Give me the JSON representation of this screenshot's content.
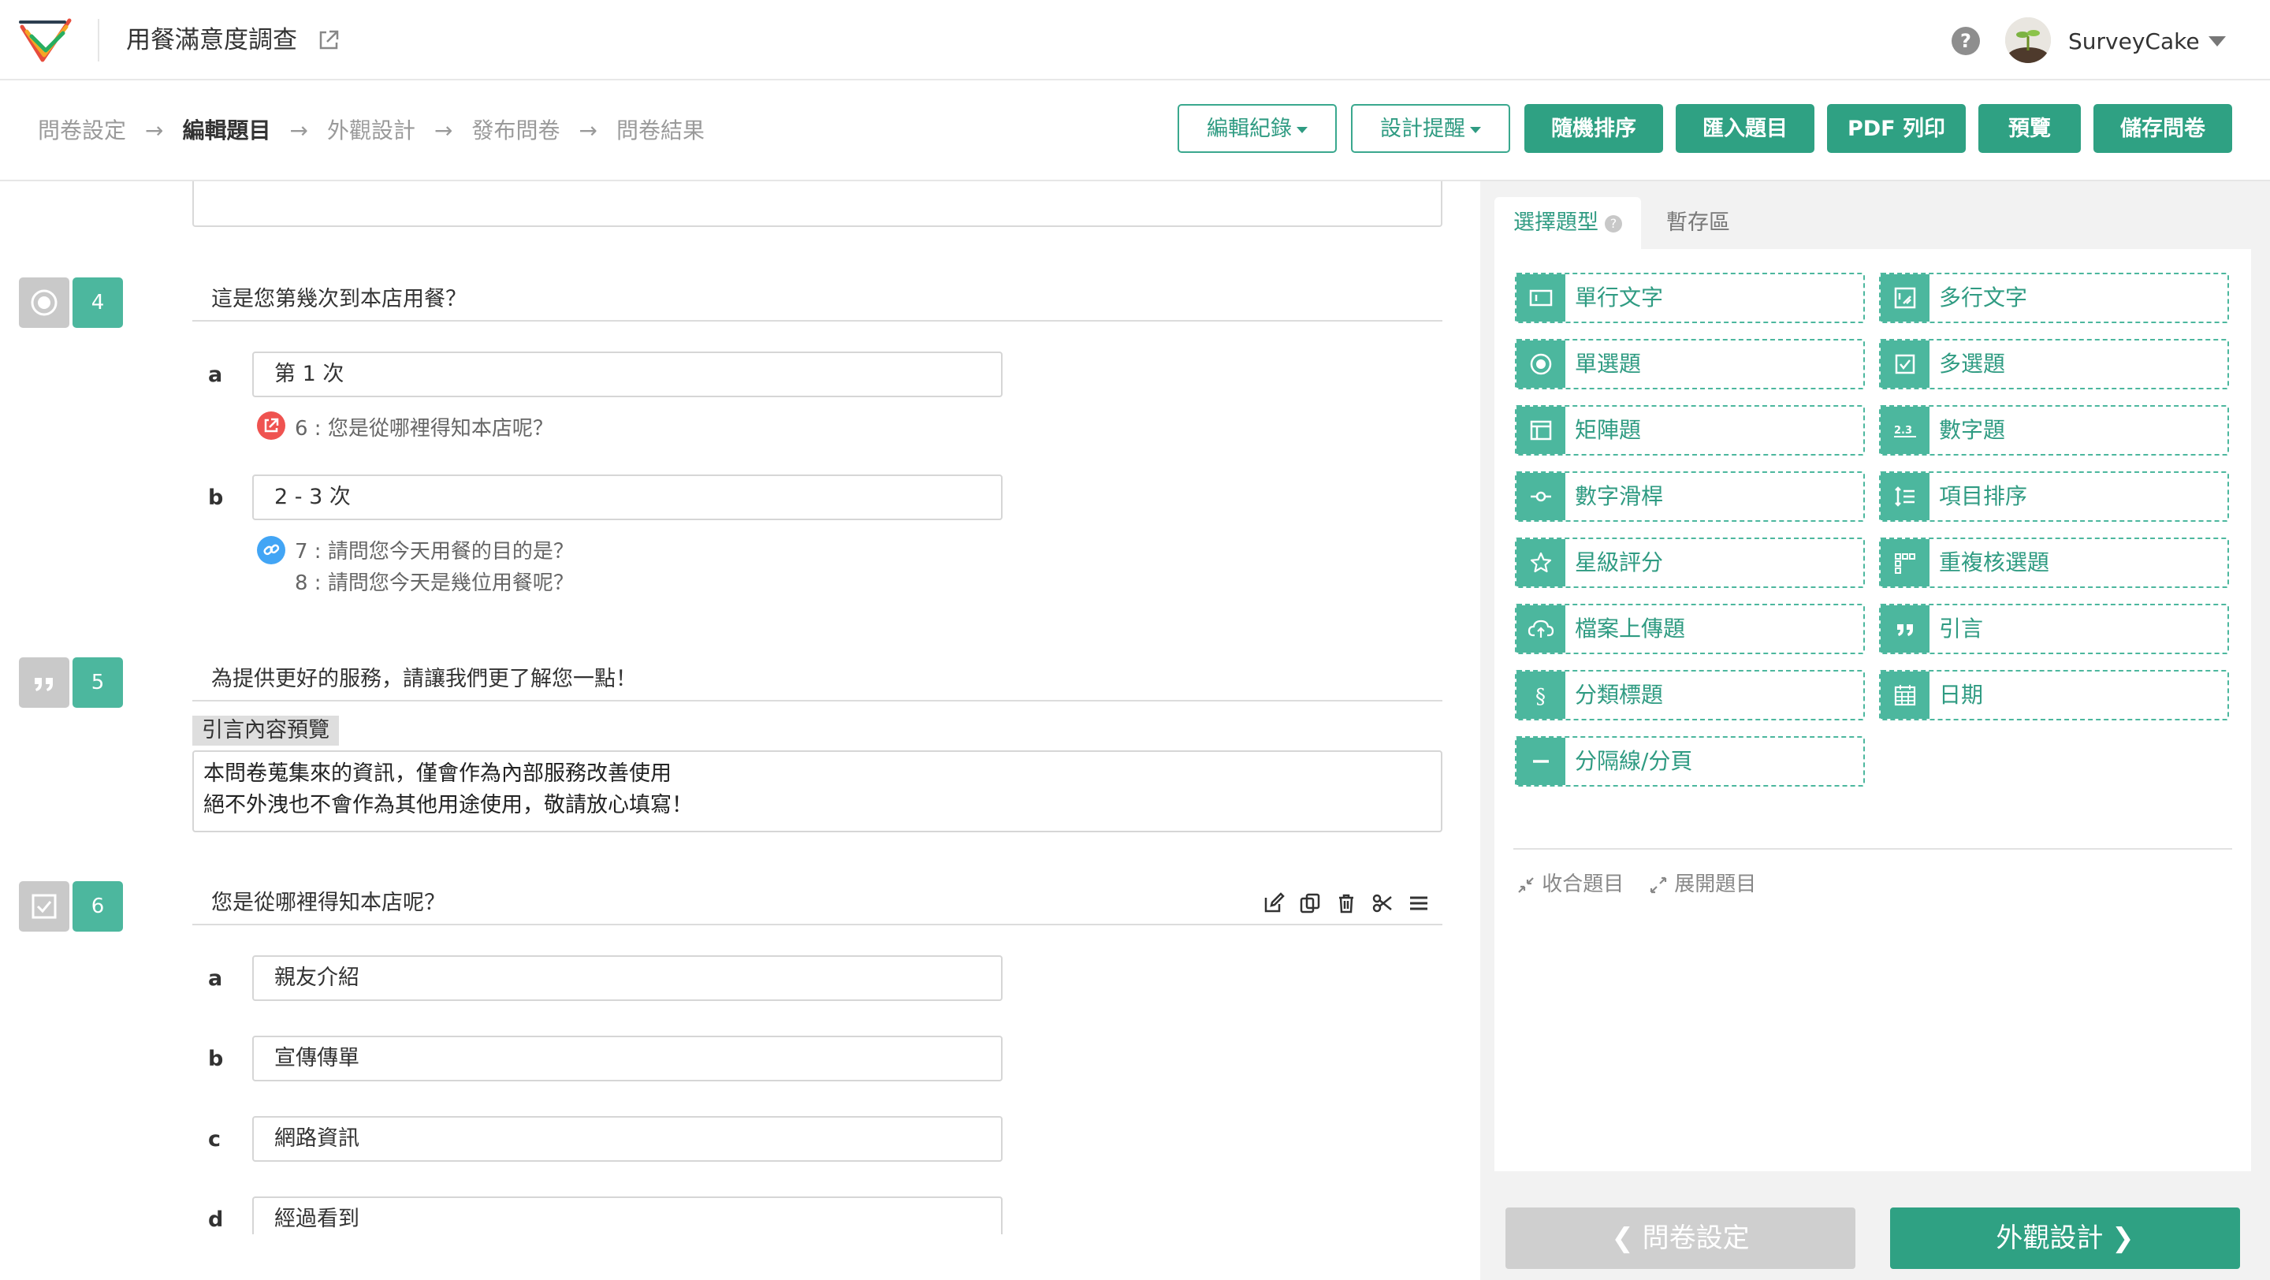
{
  "header": {
    "survey_title": "用餐滿意度調查",
    "user_name": "SurveyCake"
  },
  "breadcrumb": [
    "問卷設定",
    "編輯題目",
    "外觀設計",
    "發布問卷",
    "問卷結果"
  ],
  "toolbar": {
    "edit_history": "編輯紀錄",
    "design_tips": "設計提醒",
    "random_order": "隨機排序",
    "import_questions": "匯入題目",
    "pdf_print": "PDF 列印",
    "preview": "預覽",
    "save": "儲存問卷"
  },
  "main": {
    "q4": {
      "number": "4",
      "type_icon": "radio-icon",
      "title": "這是您第幾次到本店用餐？",
      "options": [
        {
          "letter": "a",
          "text": "第 1 次",
          "logic_icon": "jump-icon",
          "logic": [
            "6 : 您是從哪裡得知本店呢？"
          ]
        },
        {
          "letter": "b",
          "text": "2 - 3 次",
          "logic_icon": "link-icon",
          "logic": [
            "7 : 請問您今天用餐的目的是？",
            "8 : 請問您今天是幾位用餐呢？"
          ]
        }
      ]
    },
    "q5": {
      "number": "5",
      "type_icon": "quote-icon",
      "title": "為提供更好的服務，請讓我們更了解您一點！",
      "quote_tag": "引言內容預覽",
      "quote_lines": [
        "本問卷蒐集來的資訊，僅會作為內部服務改善使用",
        "絕不外洩也不會作為其他用途使用，敬請放心填寫！"
      ]
    },
    "q6": {
      "number": "6",
      "type_icon": "checkbox-icon",
      "title": "您是從哪裡得知本店呢？",
      "options": [
        {
          "letter": "a",
          "text": "親友介紹"
        },
        {
          "letter": "b",
          "text": "宣傳傳單"
        },
        {
          "letter": "c",
          "text": "網路資訊"
        },
        {
          "letter": "d",
          "text": "經過看到"
        }
      ]
    }
  },
  "panel": {
    "tabs": [
      "選擇題型",
      "暫存區"
    ],
    "question_types": [
      {
        "label": "單行文字",
        "icon": "single-line-text-icon"
      },
      {
        "label": "多行文字",
        "icon": "multi-line-text-icon"
      },
      {
        "label": "單選題",
        "icon": "radio-icon"
      },
      {
        "label": "多選題",
        "icon": "checkbox-icon"
      },
      {
        "label": "矩陣題",
        "icon": "matrix-icon"
      },
      {
        "label": "數字題",
        "icon": "number-icon"
      },
      {
        "label": "數字滑桿",
        "icon": "slider-icon"
      },
      {
        "label": "項目排序",
        "icon": "sort-icon"
      },
      {
        "label": "星級評分",
        "icon": "star-icon"
      },
      {
        "label": "重複核選題",
        "icon": "repeat-check-icon"
      },
      {
        "label": "檔案上傳題",
        "icon": "upload-icon"
      },
      {
        "label": "引言",
        "icon": "quote-icon"
      },
      {
        "label": "分類標題",
        "icon": "section-icon"
      },
      {
        "label": "日期",
        "icon": "calendar-icon"
      },
      {
        "label": "分隔線/分頁",
        "icon": "divider-icon"
      }
    ],
    "collapse_label": "收合題目",
    "expand_label": "展開題目"
  },
  "footer": {
    "back_label": "問卷設定",
    "next_label": "外觀設計"
  },
  "colors": {
    "accent": "#2fa183",
    "accent_light": "#4cb79e",
    "jump_red": "#ef5350",
    "link_blue": "#42a5f5"
  }
}
